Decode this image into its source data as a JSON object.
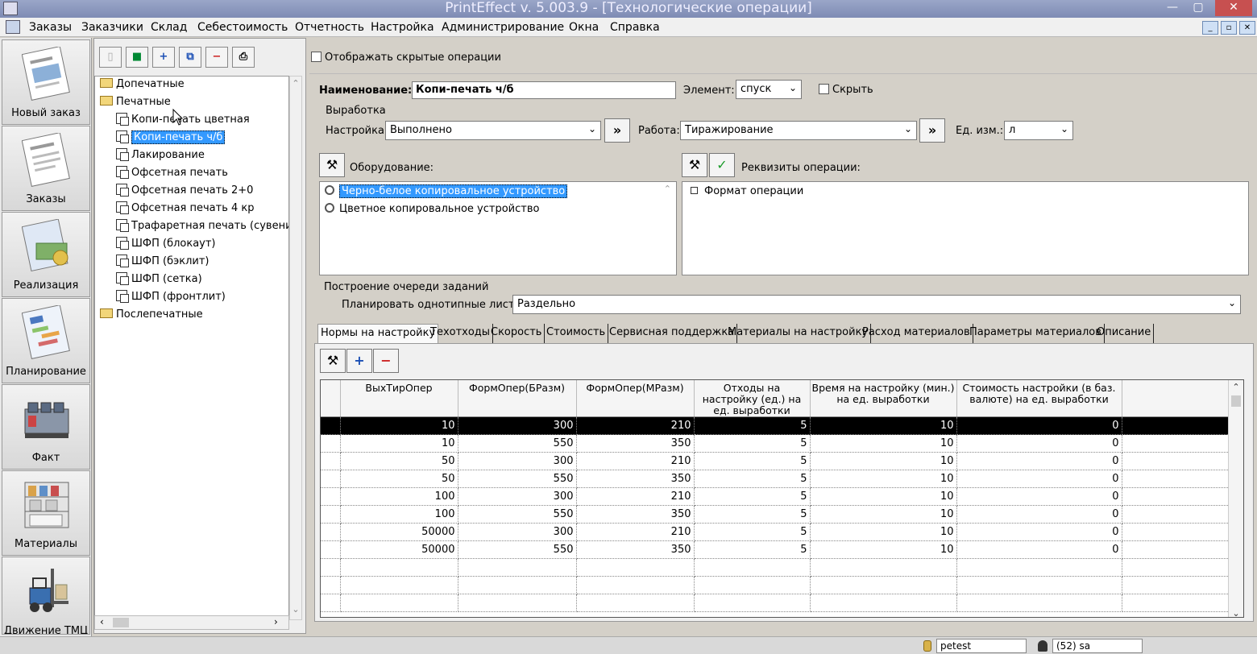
{
  "window": {
    "title": "PrintEffect v. 5.003.9 - [Технологические операции]",
    "min": "—",
    "max": "▢",
    "close": "✕"
  },
  "menu": [
    "Заказы",
    "Заказчики",
    "Склад",
    "Себестоимость",
    "Отчетность",
    "Настройка",
    "Администрирование",
    "Окна",
    "Справка"
  ],
  "mdi_buttons": [
    "_",
    "▫",
    "✕"
  ],
  "leftbar": [
    "Новый заказ",
    "Заказы",
    "Реализация",
    "Планирование",
    "Факт",
    "Материалы",
    "Движение ТМЦ"
  ],
  "toolbar": {
    "show_hidden": "Отображать скрытые операции"
  },
  "tree": {
    "groups": [
      "Допечатные",
      "Печатные",
      "Послепечатные"
    ],
    "items": [
      "Копи-печать цветная",
      "Копи-печать ч/б",
      "Лакирование",
      "Офсетная печать",
      "Офсетная печать 2+0",
      "Офсетная печать 4 кр",
      "Трафаретная печать (сувенирка)",
      "ШФП (блокаут)",
      "ШФП (бэклит)",
      "ШФП (сетка)",
      "ШФП (фронтлит)"
    ],
    "selected": "Копи-печать ч/б"
  },
  "form": {
    "name_label": "Наименование:",
    "name_value": "Копи-печать ч/б",
    "element_label": "Элемент:",
    "element_value": "спуск",
    "hide_label": "Скрыть",
    "output_group": "Выработка",
    "setup_label": "Настройка:",
    "setup_value": "Выполнено",
    "work_label": "Работа:",
    "work_value": "Тиражирование",
    "unit_label": "Ед. изм.:",
    "unit_value": "л",
    "more": "»",
    "equipment_label": "Оборудование:",
    "equipment": [
      "Черно-белое копировальное устройство",
      "Цветное копировальное устройство"
    ],
    "requisites_label": "Реквизиты операции:",
    "requisites": [
      "Формат операции"
    ],
    "queue_group": "Построение очереди заданий",
    "plan_label": "Планировать однотипные листы:",
    "plan_value": "Раздельно"
  },
  "tabs": [
    "Нормы на настройку",
    "Техотходы",
    "Скорость",
    "Стоимость",
    "Сервисная поддержка",
    "Материалы на настройку",
    "Расход материалов",
    "Параметры материалов",
    "Описание"
  ],
  "grid": {
    "columns": [
      "ВыхТирОпер",
      "ФормОпер(БРазм)",
      "ФормОпер(МРазм)",
      "Отходы на настройку (ед.) на ед. выработки",
      "Время на настройку (мин.) на ед. выработки",
      "Стоимость настройки (в баз. валюте) на ед. выработки"
    ],
    "rows": [
      [
        "10",
        "300",
        "210",
        "5",
        "10",
        "0"
      ],
      [
        "10",
        "550",
        "350",
        "5",
        "10",
        "0"
      ],
      [
        "50",
        "300",
        "210",
        "5",
        "10",
        "0"
      ],
      [
        "50",
        "550",
        "350",
        "5",
        "10",
        "0"
      ],
      [
        "100",
        "300",
        "210",
        "5",
        "10",
        "0"
      ],
      [
        "100",
        "550",
        "350",
        "5",
        "10",
        "0"
      ],
      [
        "50000",
        "300",
        "210",
        "5",
        "10",
        "0"
      ],
      [
        "50000",
        "550",
        "350",
        "5",
        "10",
        "0"
      ]
    ]
  },
  "status": {
    "db": "petest",
    "user": "(52) sa"
  },
  "colors": {
    "selection": "#3399ff",
    "title_bar": "#8b97be",
    "highlight_row": "#000000"
  }
}
